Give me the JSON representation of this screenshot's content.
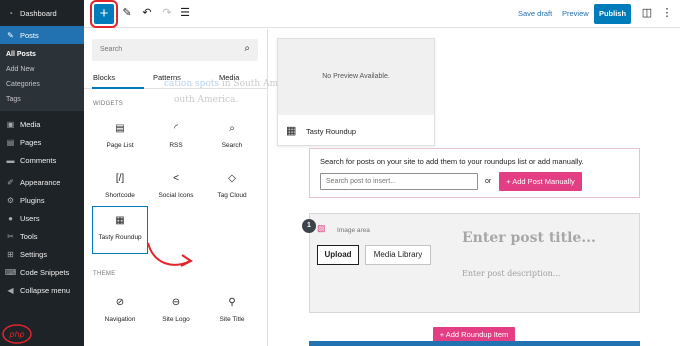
{
  "admin_menu": {
    "items": [
      {
        "label": "Dashboard",
        "icon": "dashboard-icon"
      },
      {
        "label": "Posts",
        "icon": "pushpin-icon",
        "active": true
      },
      {
        "label": "Media",
        "icon": "media-icon"
      },
      {
        "label": "Pages",
        "icon": "pages-icon"
      },
      {
        "label": "Comments",
        "icon": "comments-icon"
      },
      {
        "label": "Appearance",
        "icon": "appearance-icon"
      },
      {
        "label": "Plugins",
        "icon": "plugins-icon"
      },
      {
        "label": "Users",
        "icon": "users-icon"
      },
      {
        "label": "Tools",
        "icon": "tools-icon"
      },
      {
        "label": "Settings",
        "icon": "settings-icon"
      },
      {
        "label": "Code Snippets",
        "icon": "code-snippets-icon"
      },
      {
        "label": "Collapse menu",
        "icon": "collapse-icon"
      }
    ],
    "posts_submenu": [
      "All Posts",
      "Add New",
      "Categories",
      "Tags"
    ]
  },
  "toolbar": {
    "add_block": "+",
    "save_draft": "Save draft",
    "preview": "Preview",
    "publish": "Publish"
  },
  "inserter": {
    "search_placeholder": "Search",
    "tabs": [
      "Blocks",
      "Patterns",
      "Media"
    ],
    "section_widgets": "WIDGETS",
    "section_theme": "THEME",
    "widget_blocks": [
      {
        "label": "Page List",
        "icon": "page-list-icon"
      },
      {
        "label": "RSS",
        "icon": "rss-icon"
      },
      {
        "label": "Search",
        "icon": "search-icon"
      },
      {
        "label": "Shortcode",
        "icon": "shortcode-icon"
      },
      {
        "label": "Social Icons",
        "icon": "share-icon"
      },
      {
        "label": "Tag Cloud",
        "icon": "tag-icon"
      },
      {
        "label": "Tasty Roundup",
        "icon": "tasty-roundup-icon",
        "selected": true
      }
    ],
    "theme_blocks": [
      {
        "label": "Navigation",
        "icon": "navigation-icon"
      },
      {
        "label": "Site Logo",
        "icon": "site-logo-icon"
      },
      {
        "label": "Site Title",
        "icon": "site-title-icon"
      }
    ]
  },
  "block_preview": {
    "no_preview": "No Preview Available.",
    "block_name": "Tasty Roundup"
  },
  "canvas": {
    "ghost_line1_link": "cation spots",
    "ghost_line1_rest": " in South America? See our pick of the",
    "ghost_line2": "outh America."
  },
  "roundup": {
    "instructions": "Search for posts on your site to add them to your roundups list or add manually.",
    "search_placeholder": "Search post to insert...",
    "or_label": "or",
    "add_manually": "+ Add Post Manually",
    "item_number": "1",
    "image_area": "Image area",
    "upload": "Upload",
    "media_library": "Media Library",
    "title_placeholder": "Enter post title...",
    "desc_placeholder": "Enter post description...",
    "add_item": "+ Add Roundup Item"
  },
  "colors": {
    "admin_bg": "#1d2327",
    "wp_blue": "#007cba",
    "pink": "#e33e84",
    "highlight_red": "#e0252c"
  }
}
